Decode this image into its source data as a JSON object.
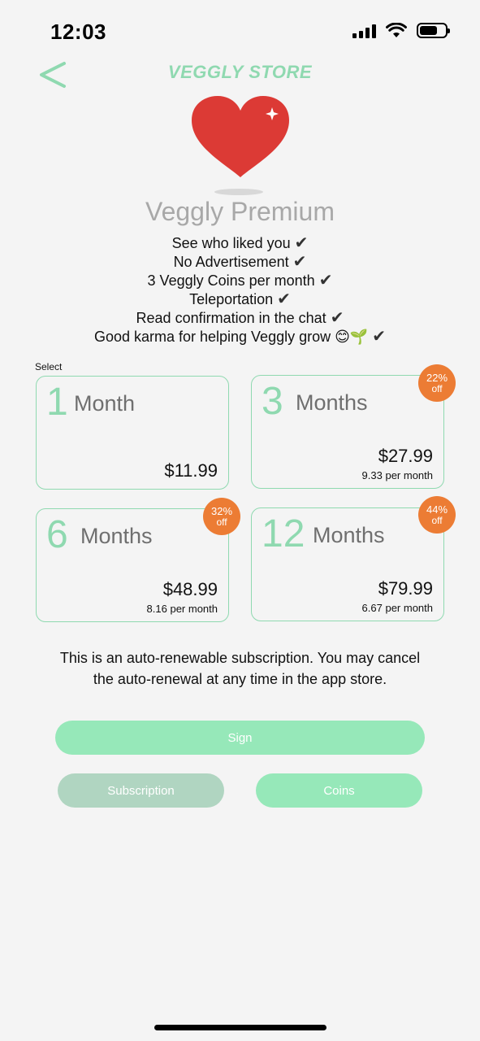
{
  "status_bar": {
    "time": "12:03"
  },
  "header": {
    "title": "VEGGLY STORE"
  },
  "colors": {
    "accent": "#8fd9b0",
    "badge": "#ec7c34",
    "button": "#96e8b9",
    "button_muted": "#b0d5c1",
    "heart": "#dc3a35"
  },
  "product": {
    "title": "Veggly Premium",
    "features": [
      "See who liked you",
      "No Advertisement",
      "3 Veggly Coins per month",
      "Teleportation",
      "Read confirmation in the chat",
      "Good karma for helping Veggly grow 😊🌱"
    ],
    "check": "✔"
  },
  "plans": {
    "select_label": "Select",
    "items": [
      {
        "num": "1",
        "unit": "Month",
        "price": "$11.99",
        "per": "",
        "discount": "",
        "off": ""
      },
      {
        "num": "3",
        "unit": "Months",
        "price": "$27.99",
        "per": "9.33 per month",
        "discount": "22%",
        "off": "off"
      },
      {
        "num": "6",
        "unit": "Months",
        "price": "$48.99",
        "per": "8.16 per month",
        "discount": "32%",
        "off": "off"
      },
      {
        "num": "12",
        "unit": "Months",
        "price": "$79.99",
        "per": "6.67 per month",
        "discount": "44%",
        "off": "off"
      }
    ]
  },
  "notice": "This is an auto-renewable subscription. You may cancel the auto-renewal at any time in the app store.",
  "buttons": {
    "sign": "Sign",
    "subscription": "Subscription",
    "coins": "Coins"
  }
}
